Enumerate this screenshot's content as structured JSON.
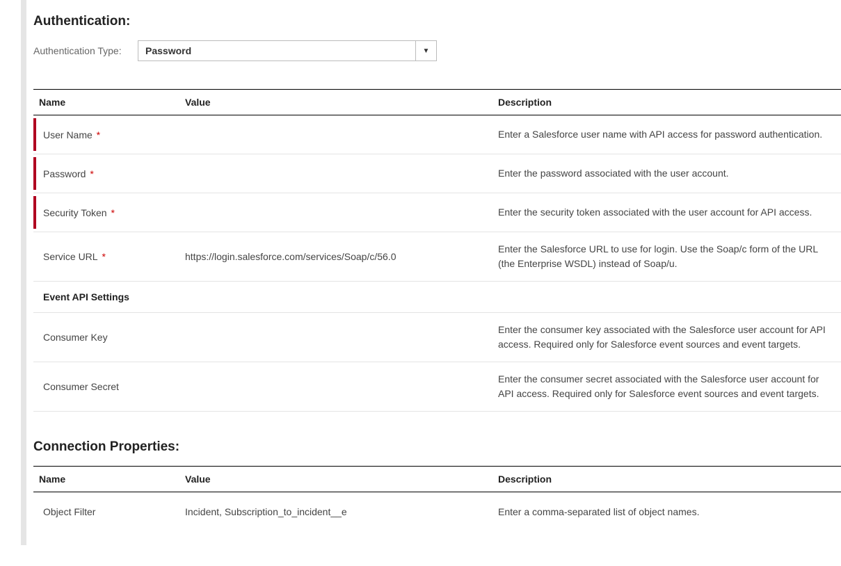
{
  "authentication": {
    "title": "Authentication:",
    "type_label": "Authentication Type:",
    "type_value": "Password"
  },
  "table1": {
    "headers": {
      "name": "Name",
      "value": "Value",
      "description": "Description"
    },
    "rows": [
      {
        "name": "User Name",
        "required": true,
        "value": "",
        "description": "Enter a Salesforce user name with API access for password authentication."
      },
      {
        "name": "Password",
        "required": true,
        "value": "",
        "description": "Enter the password associated with the user account."
      },
      {
        "name": "Security Token",
        "required": true,
        "value": "",
        "description": "Enter the security token associated with the user account for API access."
      },
      {
        "name": "Service URL",
        "required": true,
        "required_no_stripe": true,
        "value": "https://login.salesforce.com/services/Soap/c/56.0",
        "description": "Enter the Salesforce URL to use for login.  Use the Soap/c form of the URL (the Enterprise WSDL) instead of Soap/u."
      }
    ],
    "section_label": "Event API Settings",
    "rows2": [
      {
        "name": "Consumer Key",
        "required": false,
        "value": "",
        "description": "Enter the consumer key associated with the Salesforce user account for API access. Required only for Salesforce event sources and event targets."
      },
      {
        "name": "Consumer Secret",
        "required": false,
        "value": "",
        "description": "Enter the consumer secret associated with the Salesforce user account for API access. Required only for Salesforce event sources and event targets."
      }
    ]
  },
  "connection_properties": {
    "title": "Connection Properties:",
    "headers": {
      "name": "Name",
      "value": "Value",
      "description": "Description"
    },
    "rows": [
      {
        "name": "Object Filter",
        "value": "Incident, Subscription_to_incident__e",
        "description": "Enter a comma-separated list of object names."
      }
    ]
  }
}
